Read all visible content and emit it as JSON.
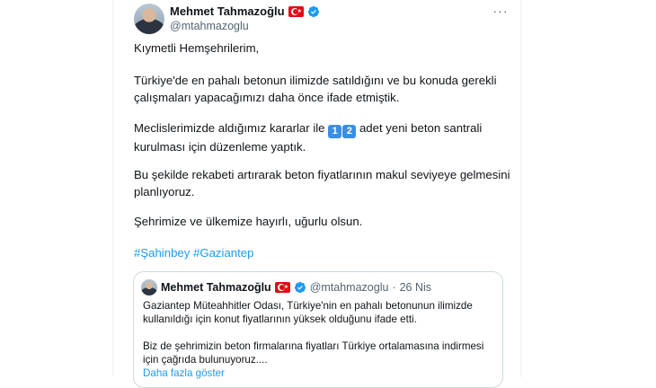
{
  "tweet": {
    "author_name": "Mehmet Tahmazoğlu",
    "author_handle": "@mtahmazoglu",
    "more_label": "···",
    "paragraphs": {
      "p1": "Kıymetli Hemşehrilerim,",
      "p2": "Türkiye'de en pahalı betonun ilimizde satıldığını ve bu konuda gerekli çalışmaları yapacağımızı daha önce ifade etmiştik.",
      "p3_before": "Meclislerimizde aldığımız kararlar ile ",
      "p3_key1": "1",
      "p3_key2": "2",
      "p3_after": " adet yeni beton santrali kurulması için düzenleme yaptık.",
      "p4": "Bu şekilde rekabeti artırarak beton fiyatlarının makul seviyeye gelmesini planlıyoruz.",
      "p5": "Şehrimize ve ülkemize hayırlı, uğurlu olsun."
    },
    "hashtags": [
      "#Şahinbey",
      "#Gaziantep"
    ]
  },
  "quote": {
    "author_name": "Mehmet Tahmazoğlu",
    "author_handle": "@mtahmazoglu",
    "separator": "·",
    "date": "26 Nis",
    "p1": "Gaziantep Müteahhitler Odası, Türkiye'nin en pahalı betonunun ilimizde kullanıldığı için konut fiyatlarının yüksek olduğunu ifade etti.",
    "p2": "Biz de şehrimizin beton firmalarına fiyatları Türkiye ortalamasına indirmesi için çağrıda bulunuyoruz....",
    "show_more": "Daha fazla göster"
  },
  "colors": {
    "link": "#1d9bf0",
    "verified": "#1d9bf0",
    "flag": "#e30a17",
    "muted_text": "#536471"
  },
  "icons": [
    "verified-badge-icon",
    "turkey-flag-icon",
    "more-options-icon",
    "keycap-1-icon",
    "keycap-2-icon"
  ]
}
